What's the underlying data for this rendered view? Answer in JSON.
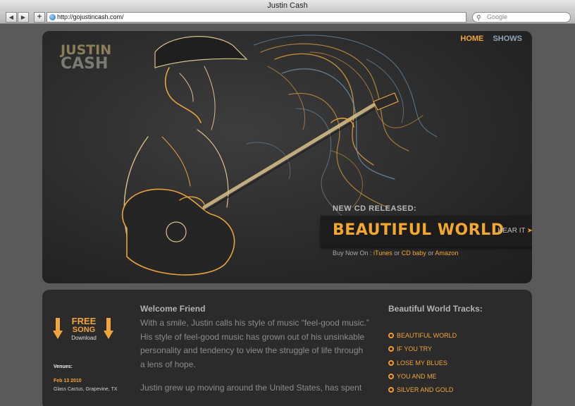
{
  "window": {
    "title": "Justin Cash"
  },
  "toolbar": {
    "back_icon": "back-arrow-icon",
    "forward_icon": "forward-arrow-icon",
    "add_icon": "plus-icon",
    "url": "http://gojustincash.com/",
    "search_placeholder": "Google"
  },
  "site": {
    "logo_line1": "JUSTIN",
    "logo_line2": "CASH",
    "nav": {
      "home": "HOME",
      "shows": "SHOWS"
    },
    "hero": {
      "cd_label": "NEW CD RELEASED:",
      "cd_title": "BEAUTIFUL WORLD",
      "hear_it": "HEAR IT",
      "buy_prefix": "Buy Now On :",
      "store_itunes": "iTunes",
      "store_or1": "or",
      "store_cdbaby": "CD baby",
      "store_or2": "or",
      "store_amazon": "Amazon"
    },
    "free_song": {
      "line1": "FREE",
      "line2": "SONG",
      "line3": "Download"
    },
    "venues": {
      "heading": "Venues:",
      "items": [
        {
          "date": "Feb 13 2010",
          "place": "Glass Cactus, Grapevine, TX"
        }
      ]
    },
    "welcome": {
      "title": "Welcome Friend",
      "p1": "With a smile, Justin calls his style of music “feel-good music.” His style of feel-good music has grown out of his unsinkable personality and tendency to view the struggle of life through a lens of hope.",
      "p2": "Justin grew up moving around the United States, has spent"
    },
    "tracks": {
      "title": "Beautiful World Tracks:",
      "items": [
        "BEAUTIFUL WORLD",
        "IF YOU TRY",
        "LOSE MY BLUES",
        "YOU AND ME",
        "SILVER AND GOLD"
      ]
    }
  },
  "colors": {
    "accent": "#f1a53a",
    "nav_secondary": "#8ea6bd",
    "panel": "#2b2b2b",
    "page_bg": "#5a5a5a"
  }
}
